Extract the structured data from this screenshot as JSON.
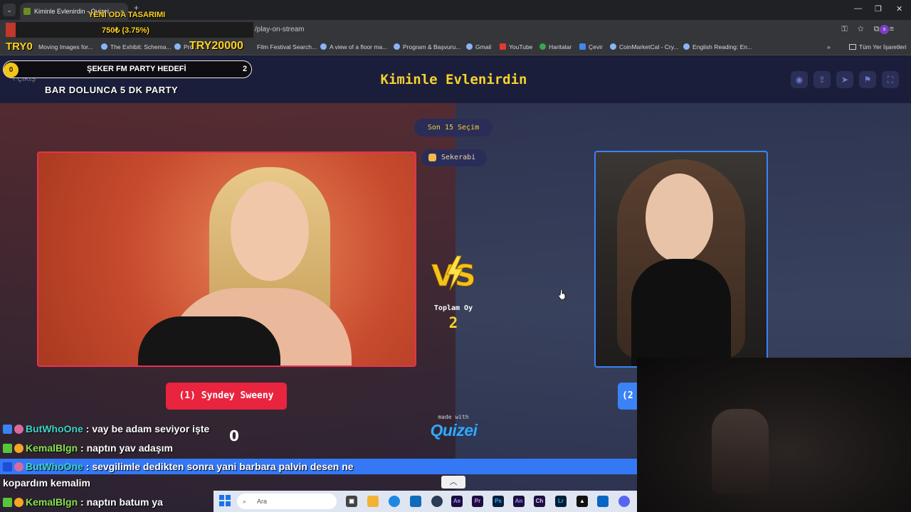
{
  "browser": {
    "tab_title": "Kiminle Evlenirdin - Quizei",
    "url": "/play-on-stream",
    "bookmarks": [
      "Moving Images for...",
      "The Exhibit: Schema...",
      "Pro...",
      "Film Festival Search...",
      "A view of a floor ma...",
      "Program & Başvuru...",
      "Gmail",
      "YouTube",
      "Haritalar",
      "Çevir",
      "CoinMarketCal - Cry...",
      "English Reading: En..."
    ],
    "all_bookmarks_label": "Tüm Yer İşaretleri",
    "profile_initial": "s"
  },
  "stream_overlay": {
    "room_title": "YENİ ODA TASARIMI",
    "goal_progress": "750₺ (3.75%)",
    "goal_fraction": 0.0375,
    "goal_min": "TRY0",
    "goal_max": "TRY20000",
    "party_count_badge": "0",
    "party_label": "ŞEKER FM PARTY HEDEFİ",
    "party_count": "2",
    "party_sub": "BAR DOLUNCA 5 DK PARTY",
    "counter": "0"
  },
  "page": {
    "title": "Kiminle Evlenirdin",
    "exit_label": "ÇIKIŞ",
    "last_choices": "Son 15 Seçim",
    "username": "Sekerabi",
    "vote_label": "Toplam Oy",
    "vote_count": "2",
    "left_name": "(1) Syndey Sweeny",
    "right_name": "(2",
    "made_with": "made with",
    "brand": "Quizei",
    "header_icons": [
      "eye-icon",
      "share-icon",
      "send-icon",
      "flag-icon",
      "fullscreen-icon"
    ],
    "accent_colors": {
      "yellow": "#f7d22e",
      "red": "#e8243f",
      "blue": "#3b82f6"
    }
  },
  "chat": [
    {
      "name": "ButWhoOne",
      "text": " : vay be adam seviyor işte"
    },
    {
      "name": "KemalBlgn",
      "text": " : naptın yav adaşım"
    },
    {
      "name": "ButWhoOne",
      "text": " : sevgilimle dedikten sonra yani barbara palvin desen ne"
    },
    {
      "continuation": "kopardım kemalim"
    },
    {
      "name": "KemalBlgn",
      "text": " : naptın batum ya"
    }
  ],
  "taskbar": {
    "search_placeholder": "Ara",
    "app_icons": [
      "Ae",
      "Pr",
      "Ps",
      "An",
      "Ch",
      "Lr"
    ]
  }
}
